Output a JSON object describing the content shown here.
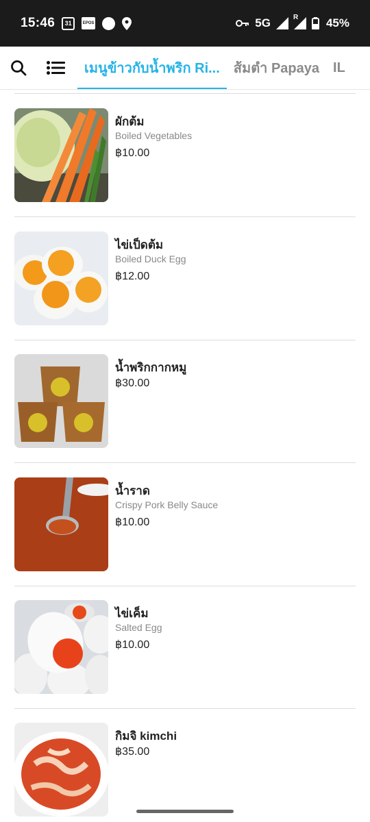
{
  "status_bar": {
    "time": "15:46",
    "calendar": "31",
    "epos": "EPOS",
    "network": "5G",
    "roaming": "R",
    "battery": "45%"
  },
  "header": {
    "search_icon": "search-icon",
    "list_icon": "list-icon",
    "tabs": [
      {
        "label": "เมนูข้าวกับน้ำพริก Ri..."
      },
      {
        "label": "ส้มตำ Papaya"
      },
      {
        "label": "IL"
      }
    ],
    "accent_color": "#25b3e8"
  },
  "items": [
    {
      "name": "ผักต้ม",
      "desc": "Boiled Vegetables",
      "price": "฿10.00"
    },
    {
      "name": "ไข่เป็ดต้ม",
      "desc": "Boiled Duck Egg",
      "price": "฿12.00"
    },
    {
      "name": "น้ำพริกกากหมู",
      "desc": "",
      "price": "฿30.00"
    },
    {
      "name": "น้ำราด",
      "desc": "Crispy Pork Belly Sauce",
      "price": "฿10.00"
    },
    {
      "name": "ไข่เค็ม",
      "desc": "Salted Egg",
      "price": "฿10.00"
    },
    {
      "name": "กิมจิ kimchi",
      "desc": "",
      "price": "฿35.00"
    }
  ]
}
